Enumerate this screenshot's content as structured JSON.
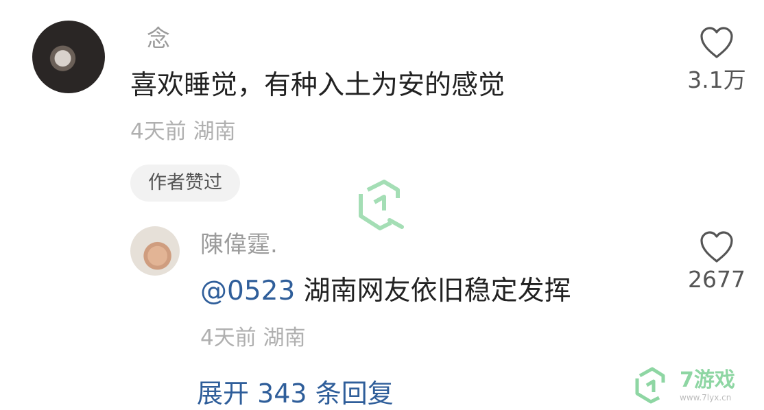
{
  "comment": {
    "username": "念",
    "text": "喜欢睡觉，有种入土为安的感觉",
    "meta": "4天前 湖南",
    "badge": "作者赞过",
    "likes": "3.1万"
  },
  "reply": {
    "username": "陳偉霆.",
    "mention": "@0523",
    "text": "湖南网友依旧稳定发挥",
    "meta": "4天前 湖南",
    "likes": "2677"
  },
  "expand_label": "展开 343 条回复",
  "watermark": {
    "brand": "7游戏",
    "url": "www.7lyx.cn"
  },
  "colors": {
    "link": "#2f5e9a",
    "watermark": "#8ed6a3"
  }
}
